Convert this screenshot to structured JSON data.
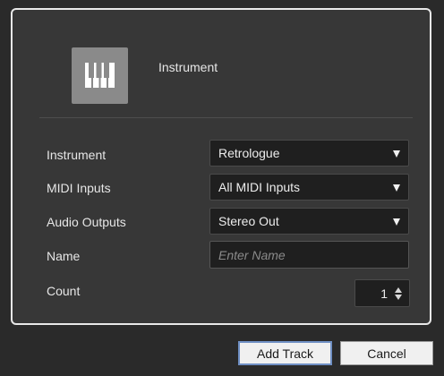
{
  "header": {
    "track_type_label": "Instrument",
    "track_type_icon": "piano-keys-icon"
  },
  "form": {
    "instrument": {
      "label": "Instrument",
      "value": "Retrologue"
    },
    "midi_inputs": {
      "label": "MIDI Inputs",
      "value": "All MIDI Inputs"
    },
    "audio_outputs": {
      "label": "Audio Outputs",
      "value": "Stereo Out"
    },
    "name": {
      "label": "Name",
      "value": "",
      "placeholder": "Enter Name"
    },
    "count": {
      "label": "Count",
      "value": "1"
    }
  },
  "footer": {
    "add_track_label": "Add Track",
    "cancel_label": "Cancel"
  },
  "colors": {
    "panel_bg": "#373737",
    "field_bg": "#1f1f1f",
    "button_bg": "#f0f0f0",
    "focus_border": "#6f8fc4"
  }
}
